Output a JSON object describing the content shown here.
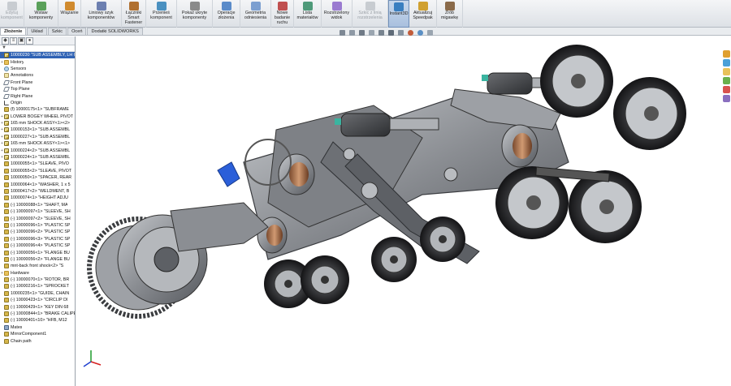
{
  "ribbon": {
    "buttons": [
      {
        "label": "Edytuj\nkomponent",
        "icon": "edit-component-icon",
        "disabled": true
      },
      {
        "label": "Wstaw\nkomponenty",
        "icon": "insert-components-icon"
      },
      {
        "label": "Wiązanie",
        "icon": "mate-icon"
      },
      {
        "label": "Liniowy szyk\nkomponentów",
        "icon": "linear-pattern-icon"
      },
      {
        "label": "Łączniki\nSmart\nFastener",
        "icon": "smart-fastener-icon"
      },
      {
        "label": "Przenieś\nkomponent",
        "icon": "move-component-icon"
      },
      {
        "label": "Pokaż ukryte\nkomponenty",
        "icon": "show-hidden-icon"
      },
      {
        "label": "Operacje\nzłożenia",
        "icon": "assembly-features-icon"
      },
      {
        "label": "Geometria\nodniesienia",
        "icon": "reference-geometry-icon"
      },
      {
        "label": "Nowe\nbadanie\nruchu",
        "icon": "motion-study-icon"
      },
      {
        "label": "Lista\nmateriałów",
        "icon": "bom-icon"
      },
      {
        "label": "Rozstrzelony\nwidok",
        "icon": "exploded-view-icon"
      },
      {
        "label": "Szkic z linią\nrozstrzelenia",
        "icon": "explode-line-sketch-icon",
        "disabled": true
      },
      {
        "label": "Instant3D",
        "icon": "instant3d-icon",
        "active": true
      },
      {
        "label": "Aktualizuj\nSpeedpak",
        "icon": "speedpak-icon"
      },
      {
        "label": "Zrób\nmigawkę",
        "icon": "snapshot-icon"
      }
    ]
  },
  "tabs": [
    "Złożenie",
    "Układ",
    "Szkic",
    "Oceń",
    "Dodatki SOLIDWORKS"
  ],
  "tree": {
    "filter_icon": "▼",
    "rows": [
      {
        "label": "10000230 \"SUB ASSEMBLY, LH C",
        "type": "assy",
        "root": true
      },
      {
        "label": "History",
        "type": "folder"
      },
      {
        "label": "Sensors",
        "type": "sensor"
      },
      {
        "label": "Annotations",
        "type": "ann"
      },
      {
        "label": "Front Plane",
        "type": "plane"
      },
      {
        "label": "Top Plane",
        "type": "plane"
      },
      {
        "label": "Right Plane",
        "type": "plane"
      },
      {
        "label": "Origin",
        "type": "origin"
      },
      {
        "label": "(f) 10000175<1> \"SUBFRAME",
        "type": "part"
      },
      {
        "label": "LOWER BOGEY WHEEL PIVOT",
        "type": "assy"
      },
      {
        "label": "165 mm SHOCK ASSY<1><2>",
        "type": "assy"
      },
      {
        "label": "10000153<1> \"SUB ASSEMBL",
        "type": "assy"
      },
      {
        "label": "10000227<1> \"SUB ASSEMBL",
        "type": "assy"
      },
      {
        "label": "165 mm SHOCK ASSY<1><1>",
        "type": "assy"
      },
      {
        "label": "10000224<2> \"SUB ASSEMBL",
        "type": "assy"
      },
      {
        "label": "10000224<1> \"SUB ASSEMBL",
        "type": "assy"
      },
      {
        "label": "10000055<1> \"SLEAVE, PIVO",
        "type": "part"
      },
      {
        "label": "10000055<2> \"SLEAVE, PIVOT",
        "type": "part"
      },
      {
        "label": "10000050<1> \"SPACER, REAR",
        "type": "part"
      },
      {
        "label": "10000064<1> \"WASHER, 1 x 5",
        "type": "part"
      },
      {
        "label": "10000417<2> \"WELDMENT, B",
        "type": "part"
      },
      {
        "label": "10000074<1> \"HEIGHT ADJU",
        "type": "part"
      },
      {
        "label": "(-) 10000088<1> \"SHAFT, MA",
        "type": "part"
      },
      {
        "label": "(-) 10000097<1> \"SLEEVE, SH",
        "type": "part"
      },
      {
        "label": "(-) 10000097<2> \"SLEEVE, SH",
        "type": "part"
      },
      {
        "label": "(-) 10000096<1> \"PLASTIC SP",
        "type": "part"
      },
      {
        "label": "(-) 10000096<2> \"PLASTIC SP",
        "type": "part"
      },
      {
        "label": "(-) 10000096<3> \"PLASTIC SP",
        "type": "part"
      },
      {
        "label": "(-) 10000096<4> \"PLASTIC SP",
        "type": "part"
      },
      {
        "label": "(-) 10000056<1> \"FLANGE BU",
        "type": "part"
      },
      {
        "label": "(-) 10000056<2> \"FLANGE BU",
        "type": "part"
      },
      {
        "label": "mnt-back front shock<2> \"S",
        "type": "part"
      },
      {
        "label": "Hardware",
        "type": "folder"
      },
      {
        "label": "(-) 10000070<1> \"ROTOR, BR",
        "type": "part"
      },
      {
        "label": "(-) 10000216<1> \"SPROCKET",
        "type": "part"
      },
      {
        "label": "10000235<1> \"GUIDE, CHAIN",
        "type": "part"
      },
      {
        "label": "(-) 10000423<1> \"CIRCLIP DI",
        "type": "part"
      },
      {
        "label": "(-) 10000429<1> \"KEY DIN 68",
        "type": "part"
      },
      {
        "label": "(-) 10000844<1> \"BRAKE CALIPE",
        "type": "part"
      },
      {
        "label": "(-) 10000401<10> \"HFB, M12",
        "type": "part"
      },
      {
        "label": "Mates",
        "type": "mate"
      },
      {
        "label": "MirrorComponent1",
        "type": "part"
      },
      {
        "label": "Chain path",
        "type": "part"
      }
    ]
  },
  "colors": {
    "ribbon_bg": "#e3e6ea",
    "tree_selection": "#2f62b4",
    "model_metal": "#8a8d92",
    "model_dark": "#3c3e42",
    "accent_blue": "#2b5fd9",
    "tire": "#1f1f21"
  }
}
